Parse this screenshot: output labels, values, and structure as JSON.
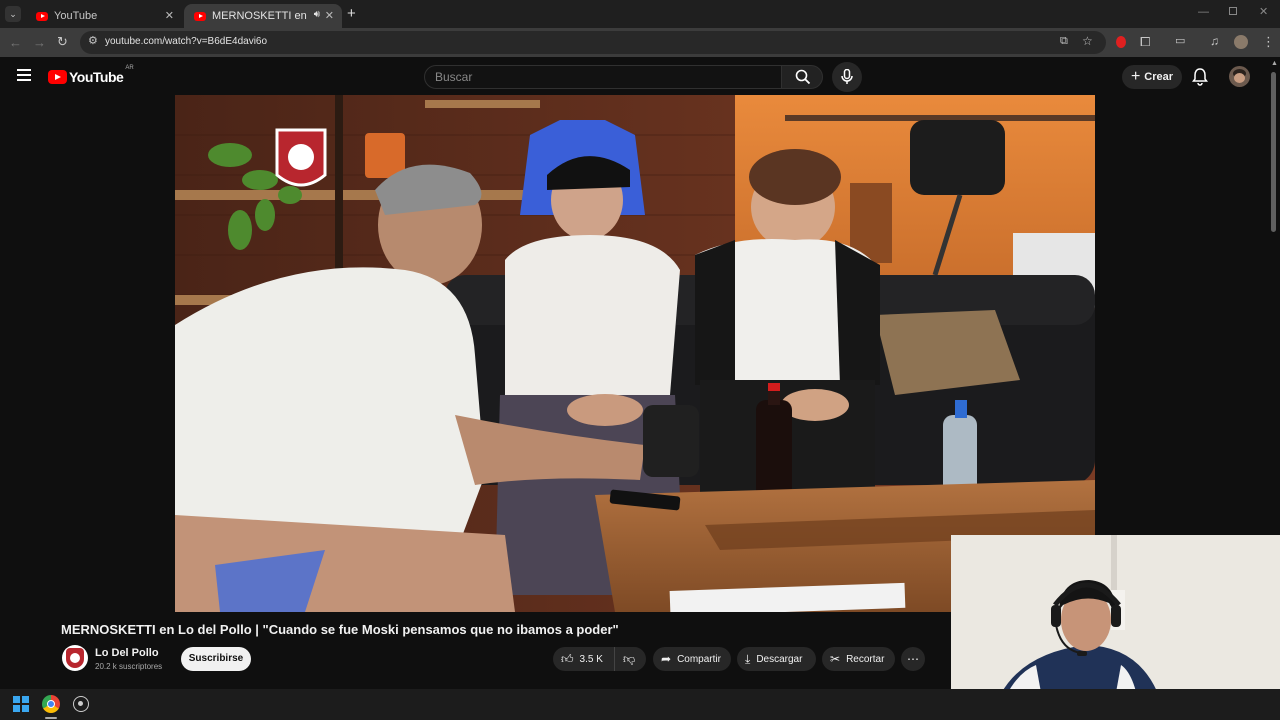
{
  "browser": {
    "tabs": [
      {
        "title": "YouTube",
        "active": false
      },
      {
        "title": "MERNOSKETTI en Lo del Pollo",
        "active": true
      }
    ],
    "url": "youtube.com/watch?v=B6dE4davi6o"
  },
  "youtube": {
    "logo_text": "YouTube",
    "region": "AR",
    "search_placeholder": "Buscar",
    "create_label": "Crear"
  },
  "video": {
    "title": "MERNOSKETTI en Lo del Pollo | \"Cuando se fue Moski pensamos que no ibamos a poder\"",
    "channel_name": "Lo Del Pollo",
    "subscribers": "20.2 k suscriptores",
    "subscribe_label": "Suscribirse",
    "likes": "3.5 K",
    "share_label": "Compartir",
    "download_label": "Descargar",
    "clip_label": "Recortar"
  },
  "colors": {
    "accent": "#ff0000",
    "background": "#0f0f0f",
    "pill": "#272727"
  }
}
